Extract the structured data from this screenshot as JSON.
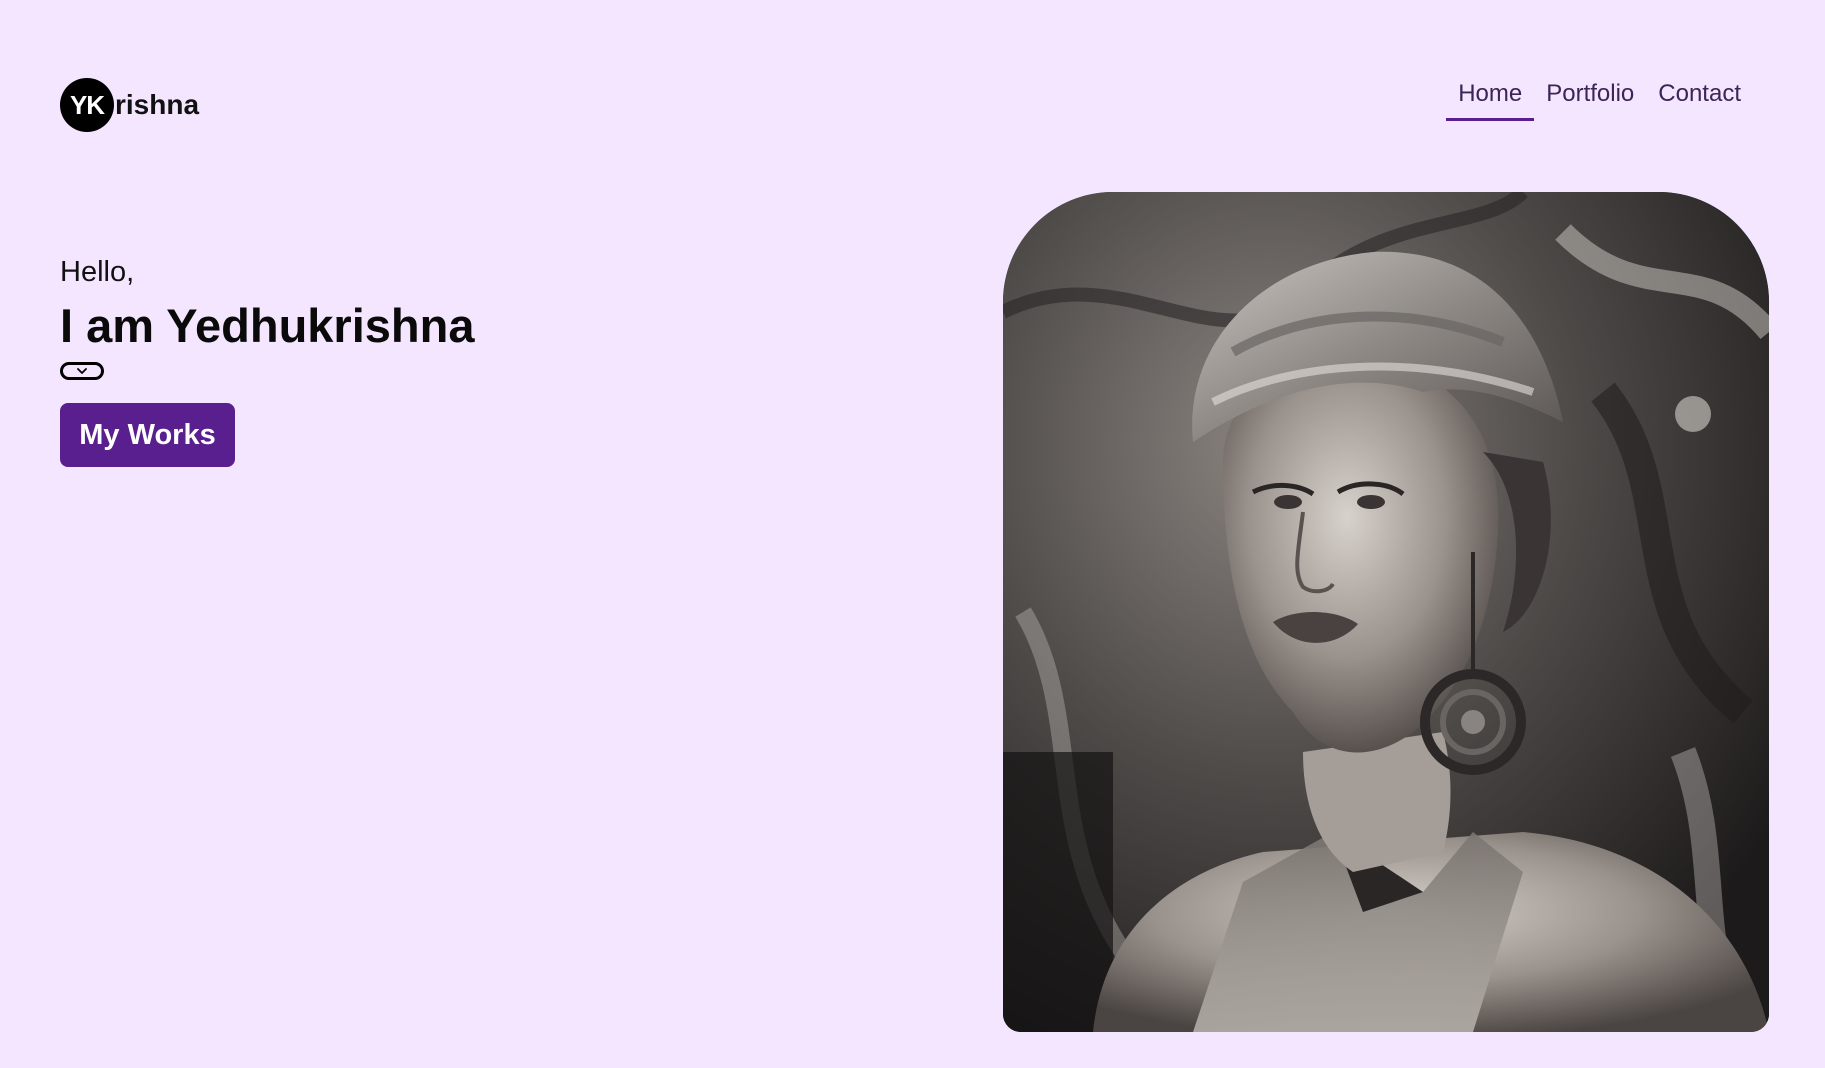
{
  "brand": {
    "badge": "YK",
    "rest": "rishna"
  },
  "nav": {
    "items": [
      {
        "label": "Home",
        "active": true
      },
      {
        "label": "Portfolio",
        "active": false
      },
      {
        "label": "Contact",
        "active": false
      }
    ]
  },
  "hero": {
    "greeting": "Hello,",
    "name": "I am Yedhukrishna",
    "cta_label": "My Works",
    "toggle_icon": "chevron-down-icon"
  },
  "portrait": {
    "subject": "woman-portrait-artwork"
  },
  "colors": {
    "background": "#f5e6ff",
    "accent": "#5a1f8f",
    "nav_text": "#3d2456"
  }
}
